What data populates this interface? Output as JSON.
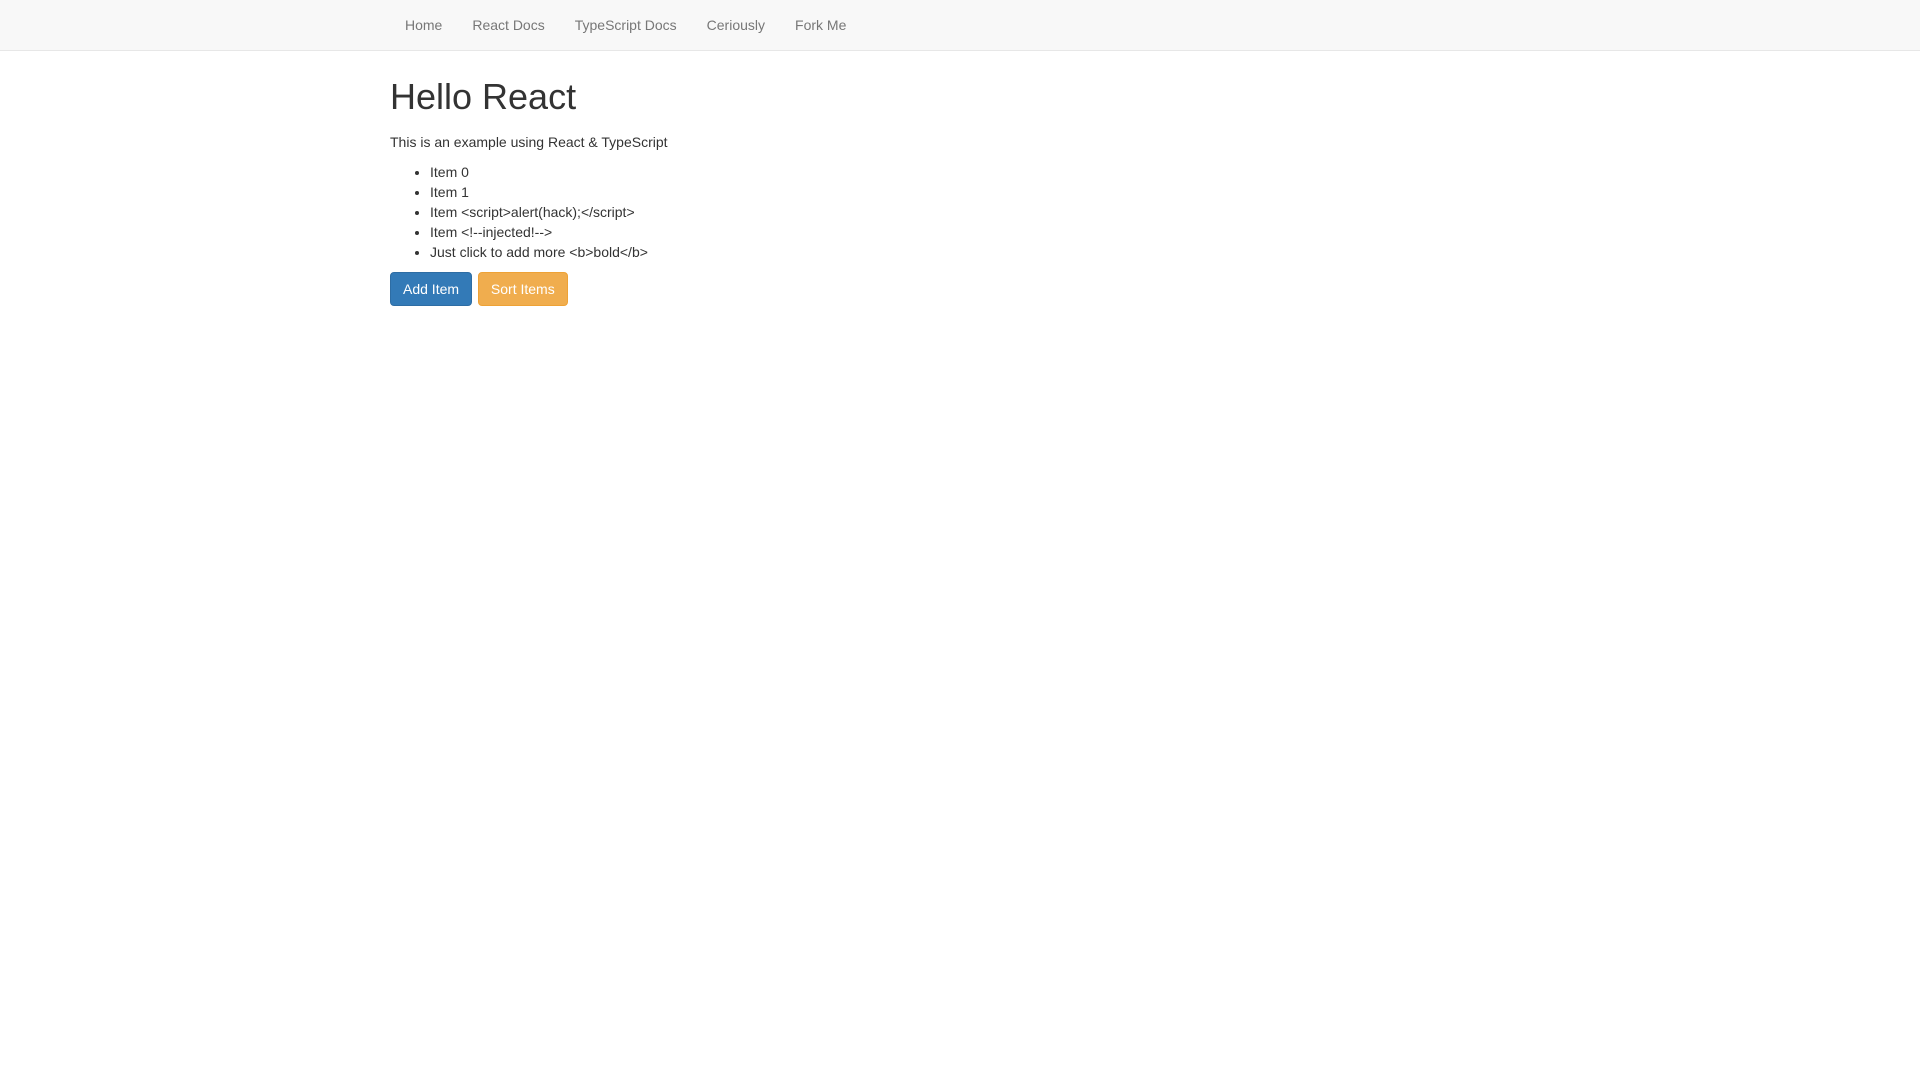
{
  "nav": {
    "items": [
      {
        "label": "Home"
      },
      {
        "label": "React Docs"
      },
      {
        "label": "TypeScript Docs"
      },
      {
        "label": "Ceriously"
      },
      {
        "label": "Fork Me"
      }
    ]
  },
  "main": {
    "heading": "Hello React",
    "subtitle": "This is an example using React & TypeScript",
    "items": [
      "Item 0",
      "Item 1",
      "Item <script>alert(hack);</script>",
      "Item <!--injected!-->",
      "Just click to add more <b>bold</b>"
    ],
    "buttons": {
      "add": "Add Item",
      "sort": "Sort Items"
    }
  }
}
